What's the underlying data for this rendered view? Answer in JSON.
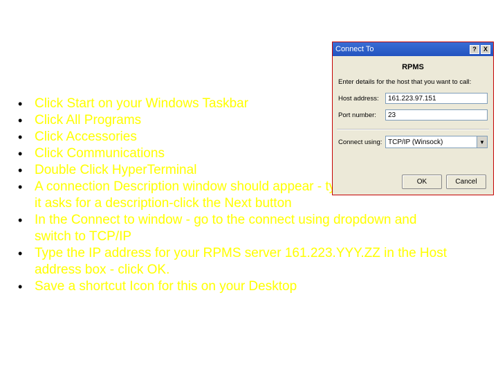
{
  "instructions": {
    "items": [
      "Click Start on your Windows Taskbar",
      "Click All Programs",
      "Click Accessories",
      "Click Communications",
      "Double Click HyperTerminal",
      "A connection Description window should appear - type in RPMS where it asks for a description-click the Next button",
      "In the Connect to window - go to the connect using dropdown and switch to TCP/IP",
      "Type the IP address for your RPMS server 161.223.YYY.ZZ in the Host address box - click OK.",
      "Save a shortcut Icon for this on your Desktop"
    ]
  },
  "dialog": {
    "title": "Connect To",
    "help_btn": "?",
    "close_btn": "X",
    "heading": "RPMS",
    "prompt": "Enter details for the host that you want to call:",
    "host_label": "Host address:",
    "host_value": "161.223.97.151",
    "port_label": "Port number:",
    "port_value": "23",
    "connect_label": "Connect using:",
    "connect_value": "TCP/IP (Winsock)",
    "ok": "OK",
    "cancel": "Cancel"
  }
}
